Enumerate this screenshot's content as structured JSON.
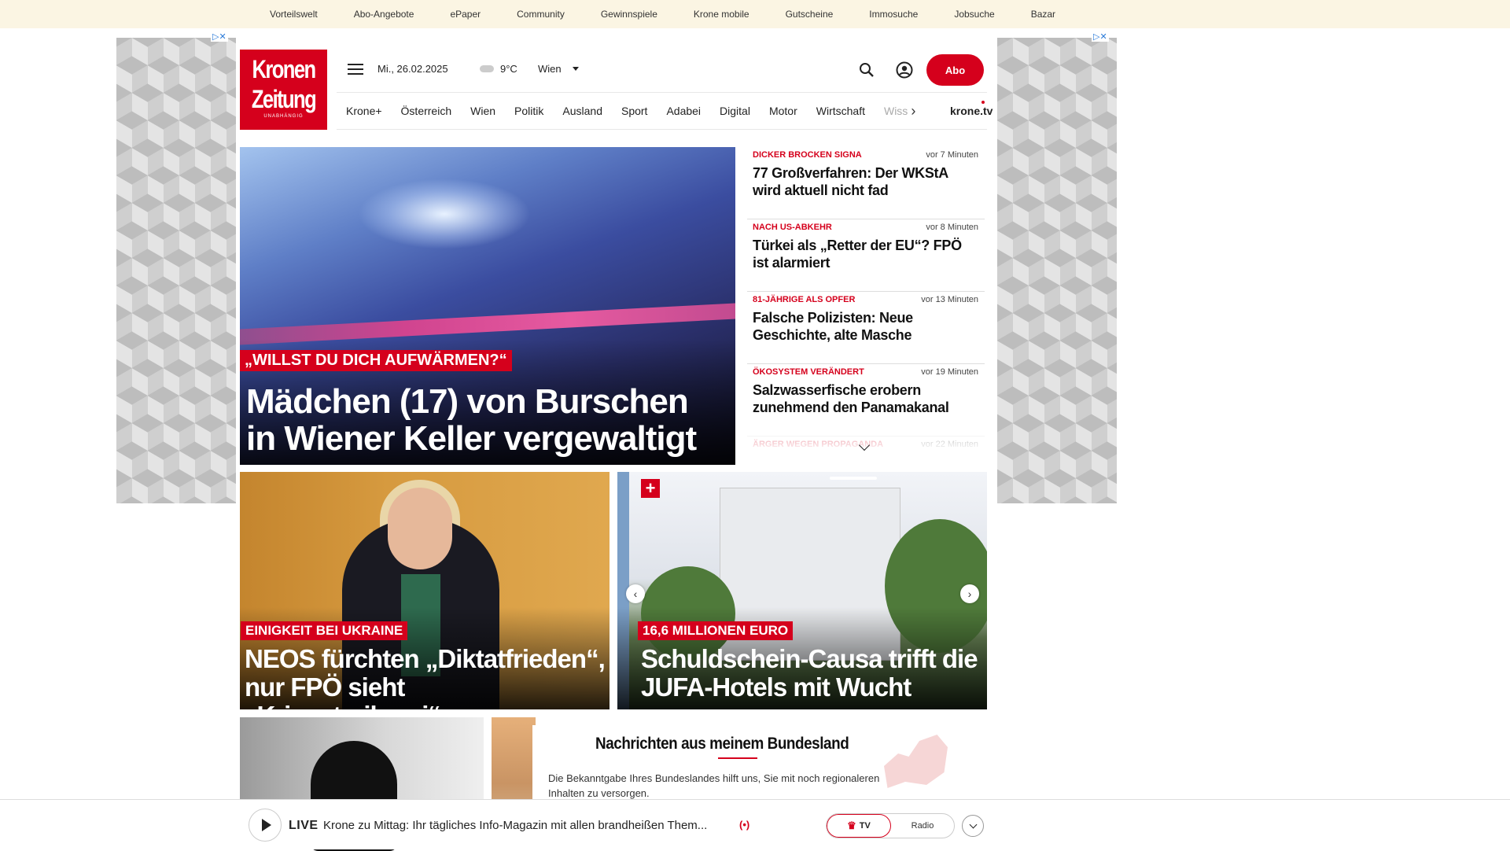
{
  "topnav": [
    "Vorteilswelt",
    "Abo-Angebote",
    "ePaper",
    "Community",
    "Gewinnspiele",
    "Krone mobile",
    "Gutscheine",
    "Immosuche",
    "Jobsuche",
    "Bazar"
  ],
  "logo": {
    "line1": "Kronen",
    "line2": "Zeitung",
    "line3": "UNABHÄNGIG"
  },
  "header": {
    "date": "Mi., 26.02.2025",
    "temp": "9°C",
    "city": "Wien",
    "abo": "Abo"
  },
  "nav": [
    "Krone+",
    "Österreich",
    "Wien",
    "Politik",
    "Ausland",
    "Sport",
    "Adabei",
    "Digital",
    "Motor",
    "Wirtschaft"
  ],
  "nav_partial": "Wiss",
  "nav_tv": "krone.tv",
  "hero": {
    "kicker": "„WILLST DU DICH AUFWÄRMEN?“",
    "title": "Mädchen (17) von Burschen in Wiener Keller vergewaltigt"
  },
  "side_news": [
    {
      "kicker": "DICKER BROCKEN SIGNA",
      "time": "vor 7 Minuten",
      "title": "77 Großverfahren: Der WKStA wird aktuell nicht fad"
    },
    {
      "kicker": "NACH US-ABKEHR",
      "time": "vor 8 Minuten",
      "title": "Türkei als „Retter der EU“? FPÖ ist alarmiert"
    },
    {
      "kicker": "81-JÄHRIGE ALS OPFER",
      "time": "vor 13 Minuten",
      "title": "Falsche Polizisten: Neue Geschichte, alte Masche"
    },
    {
      "kicker": "ÖKOSYSTEM VERÄNDERT",
      "time": "vor 19 Minuten",
      "title": "Salzwasserfische erobern zunehmend den Panamakanal"
    },
    {
      "kicker": "ÄRGER WEGEN PROPAGANDA",
      "time": "vor 22 Minuten",
      "title": ""
    }
  ],
  "card1": {
    "kicker": "EINIGKEIT BEI UKRAINE",
    "title": "NEOS fürchten „Diktatfrieden“, nur FPÖ sieht „Kriegstreiberei“"
  },
  "card2": {
    "kicker": "16,6 MILLIONEN EURO",
    "title": "Schuldschein-Causa trifft die JUFA-Hotels mit Wucht"
  },
  "bundesland": {
    "title": "Nachrichten aus meinem Bundesland",
    "text": "Die Bekanntgabe Ihres Bundeslandes hilft uns, Sie mit noch regionaleren Inhalten zu versorgen."
  },
  "player": {
    "live": "LIVE",
    "text": "Krone zu Mittag: Ihr tägliches Info-Magazin mit allen brandheißen Them...",
    "tv": "TV",
    "radio": "Radio"
  },
  "colors": {
    "brand": "#d5001c",
    "topbar": "#fbf5e3"
  }
}
